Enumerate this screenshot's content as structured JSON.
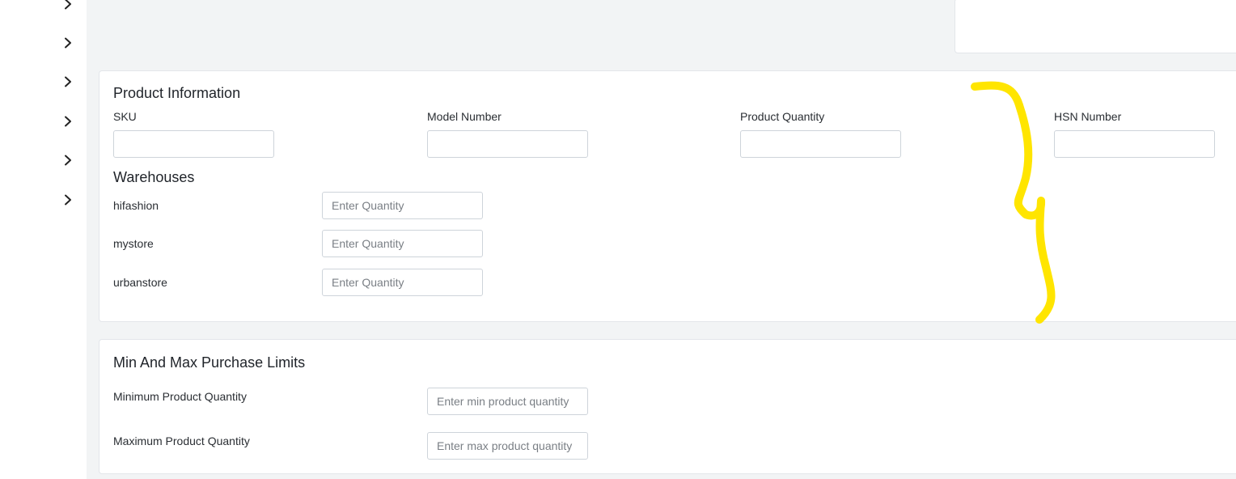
{
  "sidebar": {
    "icon_names": [
      "chevron-right-icon",
      "chevron-right-icon",
      "chevron-right-icon",
      "chevron-right-icon",
      "chevron-right-icon",
      "chevron-right-icon"
    ]
  },
  "product_info": {
    "title": "Product Information",
    "fields": [
      {
        "label": "SKU",
        "value": ""
      },
      {
        "label": "Model Number",
        "value": ""
      },
      {
        "label": "Product Quantity",
        "value": ""
      },
      {
        "label": "HSN Number",
        "value": ""
      }
    ]
  },
  "warehouses": {
    "title": "Warehouses",
    "items": [
      {
        "name": "hifashion",
        "placeholder": "Enter Quantity"
      },
      {
        "name": "mystore",
        "placeholder": "Enter Quantity"
      },
      {
        "name": "urbanstore",
        "placeholder": "Enter Quantity"
      }
    ]
  },
  "limits": {
    "title": "Min And Max Purchase Limits",
    "min_label": "Minimum Product Quantity",
    "min_placeholder": "Enter min product quantity",
    "max_label": "Maximum Product Quantity",
    "max_placeholder": "Enter max product quantity"
  },
  "colors": {
    "annotation": "#ffe500",
    "background": "#f2f4f5",
    "border": "#ced4da"
  }
}
